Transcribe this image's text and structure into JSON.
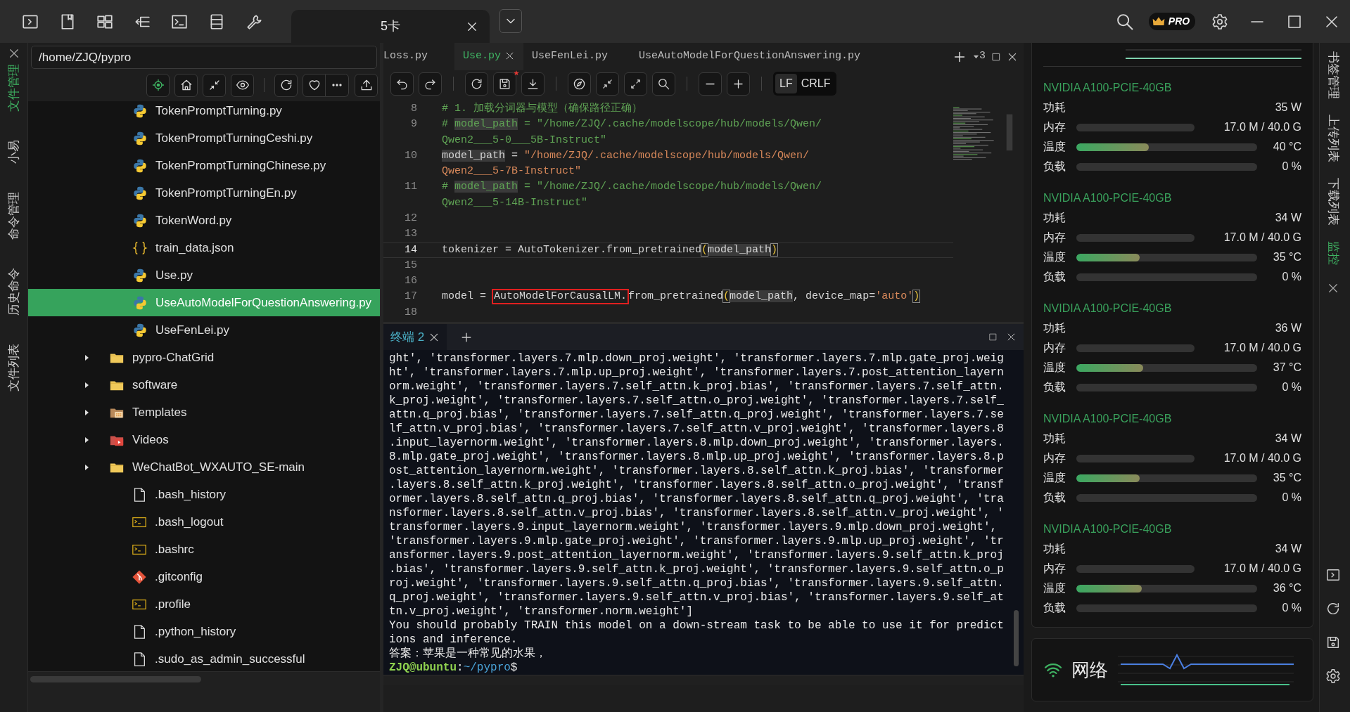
{
  "title_bar": {
    "tab": {
      "label": "5卡",
      "selected": true
    },
    "badge": "PRO"
  },
  "left_rail": [
    {
      "label": "文件管理",
      "selected": true
    },
    {
      "label": "小易",
      "selected": false
    },
    {
      "label": "命令管理",
      "selected": false
    },
    {
      "label": "历史命令",
      "selected": false
    },
    {
      "label": "文件列表",
      "selected": false
    }
  ],
  "file_panel": {
    "path": "/home/ZJQ/pypro",
    "nested_items": [
      {
        "name": "TokenPromptTurning.py",
        "kind": "python",
        "selected": false
      },
      {
        "name": "TokenPromptTurningCeshi.py",
        "kind": "python",
        "selected": false
      },
      {
        "name": "TokenPromptTurningChinese.py",
        "kind": "python",
        "selected": false
      },
      {
        "name": "TokenPromptTurningEn.py",
        "kind": "python",
        "selected": false
      },
      {
        "name": "TokenWord.py",
        "kind": "python",
        "selected": false
      },
      {
        "name": "train_data.json",
        "kind": "json",
        "selected": false
      },
      {
        "name": "Use.py",
        "kind": "python",
        "selected": false
      },
      {
        "name": "UseAutoModelForQuestionAnswering.py",
        "kind": "python",
        "selected": true
      },
      {
        "name": "UseFenLei.py",
        "kind": "python",
        "selected": false
      }
    ],
    "folders": [
      {
        "name": "pypro-ChatGrid",
        "kind": "folder",
        "expanded": false,
        "selected": false
      },
      {
        "name": "software",
        "kind": "folder",
        "expanded": false,
        "selected": false
      },
      {
        "name": "Templates",
        "kind": "templates",
        "expanded": false,
        "selected": false
      },
      {
        "name": "Videos",
        "kind": "videos",
        "expanded": false,
        "selected": false
      },
      {
        "name": "WeChatBot_WXAUTO_SE-main",
        "kind": "folder",
        "expanded": false,
        "selected": false
      }
    ],
    "files": [
      {
        "name": ".bash_history",
        "kind": "file",
        "selected": false
      },
      {
        "name": ".bash_logout",
        "kind": "shell",
        "selected": false
      },
      {
        "name": ".bashrc",
        "kind": "shell",
        "selected": false
      },
      {
        "name": ".gitconfig",
        "kind": "git",
        "selected": false
      },
      {
        "name": ".profile",
        "kind": "shell",
        "selected": false
      },
      {
        "name": ".python_history",
        "kind": "file",
        "selected": false
      },
      {
        "name": ".sudo_as_admin_successful",
        "kind": "file",
        "selected": false
      }
    ]
  },
  "editor": {
    "tabs": [
      {
        "label": "Loss.py",
        "selected": false
      },
      {
        "label": "Use.py",
        "selected": true
      },
      {
        "label": "UseFenLei.py",
        "selected": false
      },
      {
        "label": "UseAutoModelForQuestionAnswering.py",
        "selected": false
      }
    ],
    "tab_count": "3",
    "modified": true,
    "line_endings": [
      {
        "label": "LF",
        "selected": true
      },
      {
        "label": "CRLF",
        "selected": false
      }
    ],
    "code_lines": [
      {
        "number": "8",
        "current": false,
        "segments": [
          {
            "text": "# 1. 加载分词器与模型（确保路径正确）",
            "kind": "comment"
          }
        ]
      },
      {
        "number": "9",
        "current": false,
        "segments": [
          {
            "text": "# ",
            "kind": "comment"
          },
          {
            "text": "model_path",
            "kind": "comment-match"
          },
          {
            "text": " = \"/home/ZJQ/.cache/modelscope/hub/models/Qwen/",
            "kind": "comment"
          }
        ]
      },
      {
        "current": false,
        "segments": [
          {
            "text": "Qwen2___5-0___5B-Instruct\"",
            "kind": "comment"
          }
        ]
      },
      {
        "number": "10",
        "current": false,
        "segments": [
          {
            "text": "model_path",
            "kind": "match"
          },
          {
            "text": " = ",
            "kind": "plain"
          },
          {
            "text": "\"/home/ZJQ/.cache/modelscope/hub/models/Qwen/",
            "kind": "string"
          }
        ]
      },
      {
        "current": false,
        "segments": [
          {
            "text": "Qwen2___5-7B-Instruct\"",
            "kind": "string"
          }
        ]
      },
      {
        "number": "11",
        "current": false,
        "segments": [
          {
            "text": "# ",
            "kind": "comment"
          },
          {
            "text": "model_path",
            "kind": "comment-match"
          },
          {
            "text": " = \"/home/ZJQ/.cache/modelscope/hub/models/Qwen/",
            "kind": "comment"
          }
        ]
      },
      {
        "current": false,
        "segments": [
          {
            "text": "Qwen2___5-14B-Instruct\"",
            "kind": "comment"
          }
        ]
      },
      {
        "number": "12",
        "current": false
      },
      {
        "number": "13",
        "current": false
      },
      {
        "number": "14",
        "current": true,
        "segments": [
          {
            "text": "tokenizer = AutoTokenizer.from_pretrained",
            "kind": "plain"
          },
          {
            "text": "(",
            "kind": "bracket"
          },
          {
            "text": "model_path",
            "kind": "match"
          },
          {
            "text": ")",
            "kind": "bracket"
          }
        ]
      },
      {
        "number": "15",
        "current": false
      },
      {
        "number": "16",
        "current": false
      },
      {
        "number": "17",
        "current": false,
        "segments": [
          {
            "text": "model = ",
            "kind": "plain"
          },
          {
            "text": "AutoModelForCausalLM.",
            "kind": "boxed"
          },
          {
            "text": "from_pretrained",
            "kind": "plain"
          },
          {
            "text": "(",
            "kind": "bracket"
          },
          {
            "text": "model_path",
            "kind": "match"
          },
          {
            "text": ", device_map=",
            "kind": "plain"
          },
          {
            "text": "'auto'",
            "kind": "string"
          },
          {
            "text": ")",
            "kind": "bracket"
          }
        ]
      },
      {
        "number": "18",
        "current": false
      }
    ]
  },
  "terminal": {
    "tabs": [
      {
        "label": "终端 2",
        "selected": true
      }
    ],
    "lines": [
      "ght', 'transformer.layers.7.mlp.down_proj.weight', 'transformer.layers.7.mlp.gate_proj.weig",
      "ht', 'transformer.layers.7.mlp.up_proj.weight', 'transformer.layers.7.post_attention_layern",
      "orm.weight', 'transformer.layers.7.self_attn.k_proj.bias', 'transformer.layers.7.self_attn.",
      "k_proj.weight', 'transformer.layers.7.self_attn.o_proj.weight', 'transformer.layers.7.self_",
      "attn.q_proj.bias', 'transformer.layers.7.self_attn.q_proj.weight', 'transformer.layers.7.se",
      "lf_attn.v_proj.bias', 'transformer.layers.7.self_attn.v_proj.weight', 'transformer.layers.8",
      ".input_layernorm.weight', 'transformer.layers.8.mlp.down_proj.weight', 'transformer.layers.",
      "8.mlp.gate_proj.weight', 'transformer.layers.8.mlp.up_proj.weight', 'transformer.layers.8.p",
      "ost_attention_layernorm.weight', 'transformer.layers.8.self_attn.k_proj.bias', 'transformer",
      ".layers.8.self_attn.k_proj.weight', 'transformer.layers.8.self_attn.o_proj.weight', 'transf",
      "ormer.layers.8.self_attn.q_proj.bias', 'transformer.layers.8.self_attn.q_proj.weight', 'tra",
      "nsformer.layers.8.self_attn.v_proj.bias', 'transformer.layers.8.self_attn.v_proj.weight', '",
      "transformer.layers.9.input_layernorm.weight', 'transformer.layers.9.mlp.down_proj.weight',",
      "'transformer.layers.9.mlp.gate_proj.weight', 'transformer.layers.9.mlp.up_proj.weight', 'tr",
      "ansformer.layers.9.post_attention_layernorm.weight', 'transformer.layers.9.self_attn.k_proj",
      ".bias', 'transformer.layers.9.self_attn.k_proj.weight', 'transformer.layers.9.self_attn.o_p",
      "roj.weight', 'transformer.layers.9.self_attn.q_proj.bias', 'transformer.layers.9.self_attn.",
      "q_proj.weight', 'transformer.layers.9.self_attn.v_proj.bias', 'transformer.layers.9.self_at",
      "tn.v_proj.weight', 'transformer.norm.weight']",
      "You should probably TRAIN this model on a down-stream task to be able to use it for predict",
      "ions and inference.",
      "答案：苹果是一种常见的水果，"
    ],
    "prompt": {
      "user": "ZJQ@ubuntu",
      "separator": ":",
      "path": "~/pypro",
      "symbol": "$"
    }
  },
  "gpu_panel": {
    "gpus": [
      {
        "name": "NVIDIA A100-PCIE-40GB",
        "metrics": [
          {
            "label": "功耗",
            "kind": "text",
            "reading": "35 W"
          },
          {
            "label": "内存",
            "kind": "memory",
            "reading": "17.0 M / 40.0 G",
            "level": 0
          },
          {
            "label": "温度",
            "kind": "bar",
            "reading": "40 °C",
            "level": 0.4
          },
          {
            "label": "负载",
            "kind": "bar",
            "reading": "0 %",
            "level": 0
          }
        ]
      },
      {
        "name": "NVIDIA A100-PCIE-40GB",
        "metrics": [
          {
            "label": "功耗",
            "kind": "text",
            "reading": "34 W"
          },
          {
            "label": "内存",
            "kind": "memory",
            "reading": "17.0 M / 40.0 G",
            "level": 0
          },
          {
            "label": "温度",
            "kind": "bar",
            "reading": "35 °C",
            "level": 0.35
          },
          {
            "label": "负载",
            "kind": "bar",
            "reading": "0 %",
            "level": 0
          }
        ]
      },
      {
        "name": "NVIDIA A100-PCIE-40GB",
        "metrics": [
          {
            "label": "功耗",
            "kind": "text",
            "reading": "36 W"
          },
          {
            "label": "内存",
            "kind": "memory",
            "reading": "17.0 M / 40.0 G",
            "level": 0
          },
          {
            "label": "温度",
            "kind": "bar",
            "reading": "37 °C",
            "level": 0.37
          },
          {
            "label": "负载",
            "kind": "bar",
            "reading": "0 %",
            "level": 0
          }
        ]
      },
      {
        "name": "NVIDIA A100-PCIE-40GB",
        "metrics": [
          {
            "label": "功耗",
            "kind": "text",
            "reading": "34 W"
          },
          {
            "label": "内存",
            "kind": "memory",
            "reading": "17.0 M / 40.0 G",
            "level": 0
          },
          {
            "label": "温度",
            "kind": "bar",
            "reading": "35 °C",
            "level": 0.35
          },
          {
            "label": "负载",
            "kind": "bar",
            "reading": "0 %",
            "level": 0
          }
        ]
      },
      {
        "name": "NVIDIA A100-PCIE-40GB",
        "metrics": [
          {
            "label": "功耗",
            "kind": "text",
            "reading": "34 W"
          },
          {
            "label": "内存",
            "kind": "memory",
            "reading": "17.0 M / 40.0 G",
            "level": 0
          },
          {
            "label": "温度",
            "kind": "bar",
            "reading": "36 °C",
            "level": 0.36
          },
          {
            "label": "负载",
            "kind": "bar",
            "reading": "0 %",
            "level": 0
          }
        ]
      }
    ],
    "network": {
      "label": "网络"
    }
  },
  "right_rail": [
    {
      "label": "书签管理",
      "selected": false
    },
    {
      "label": "上传列表",
      "selected": false
    },
    {
      "label": "下载列表",
      "selected": false
    },
    {
      "label": "监控",
      "selected": true
    }
  ]
}
